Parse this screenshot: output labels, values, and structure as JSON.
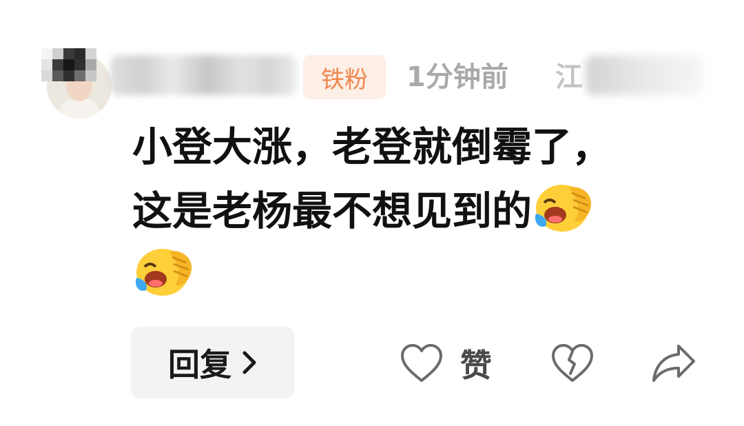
{
  "header": {
    "badge_label": "铁粉",
    "time_label": "1分钟前",
    "location_partial": "江"
  },
  "comment": {
    "line1": "小登大涨，老登就倒霉了，",
    "line2": "这是老杨最不想见到的"
  },
  "actions": {
    "reply_label": "回复",
    "like_label": "赞"
  },
  "icons": {
    "emoji": "face-holding-back-tears-laughing",
    "like": "heart-outline-icon",
    "dislike": "broken-heart-icon",
    "share": "share-arrow-icon",
    "reply_chevron": "chevron-right-icon"
  }
}
